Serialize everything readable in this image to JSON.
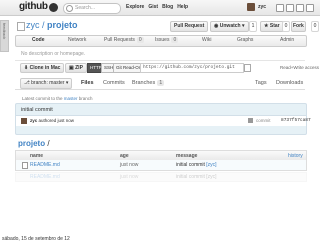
{
  "header": {
    "logo": "github",
    "search_placeholder": "Search...",
    "nav": [
      "Explore",
      "Gist",
      "Blog",
      "Help"
    ],
    "username": "zyc",
    "side_tab": "feedback"
  },
  "repo": {
    "owner": "zyc",
    "name": "projeto",
    "separator": " / ",
    "buttons": {
      "pull_request": "Pull Request",
      "watch": "Unwatch",
      "watch_count": "1",
      "star": "Star",
      "star_count": "0",
      "fork": "Fork",
      "fork_count": "0"
    }
  },
  "tabs": [
    {
      "label": "Code",
      "count": ""
    },
    {
      "label": "Network",
      "count": ""
    },
    {
      "label": "Pull Requests",
      "count": "0"
    },
    {
      "label": "Issues",
      "count": "0"
    },
    {
      "label": "Wiki",
      "count": ""
    },
    {
      "label": "Graphs",
      "count": ""
    },
    {
      "label": "Admin",
      "count": ""
    }
  ],
  "description_placeholder": "No description or homepage.",
  "clone": {
    "mac": "Clone in Mac",
    "zip": "ZIP",
    "protocols": [
      "HTTP",
      "SSH",
      "Git Read-Only"
    ],
    "url": "https://github.com/zyc/projeto.git",
    "access": "Read+Write access"
  },
  "branch": {
    "label": "branch: master",
    "subtabs": [
      {
        "label": "Files",
        "count": ""
      },
      {
        "label": "Commits",
        "count": ""
      },
      {
        "label": "Branches",
        "count": "1"
      }
    ],
    "right_tabs": [
      "Tags",
      "Downloads"
    ]
  },
  "latest_commit": {
    "prefix": "Latest commit to the ",
    "branch": "master",
    "suffix": " branch",
    "message": "initial commit",
    "author": "zyc",
    "authored": " authored just now",
    "sha_label": "commit",
    "sha": "8737f57ca87"
  },
  "path": {
    "name": "projeto",
    "sep": " /"
  },
  "files": {
    "headers": [
      "name",
      "age",
      "message",
      "history"
    ],
    "rows": [
      {
        "name": "README.md",
        "age": "just now",
        "message": "initial commit ",
        "link": "[zyc]"
      }
    ]
  },
  "ghost_rows": [
    {
      "name": "README.md",
      "age": "just now",
      "message": "initial commit [zyc]"
    }
  ],
  "timestamp": "sábado, 15 de setembro de 12"
}
